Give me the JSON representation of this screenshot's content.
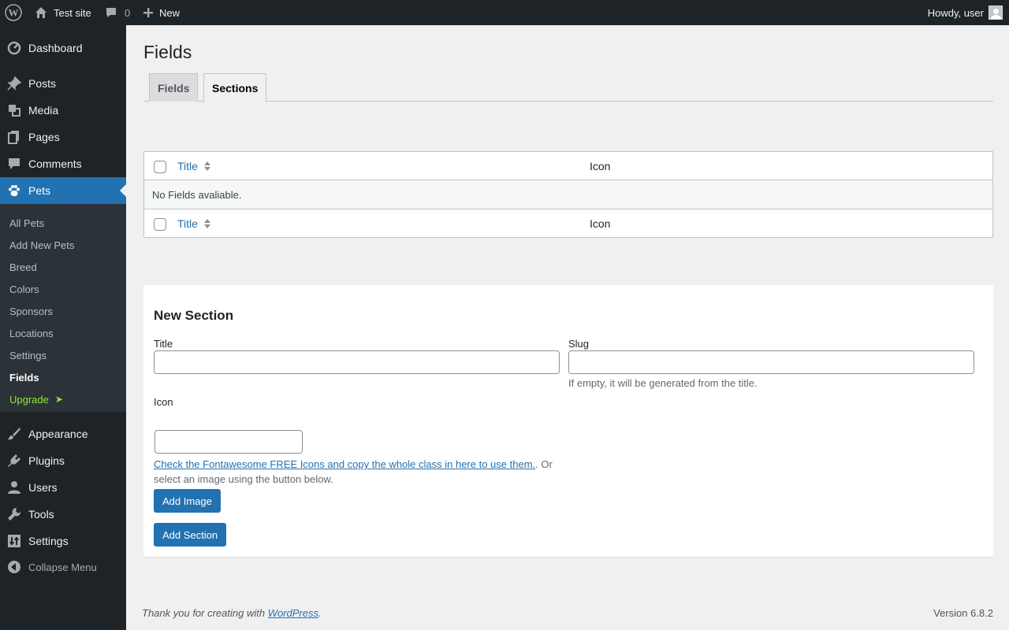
{
  "adminbar": {
    "site_name": "Test site",
    "comments_count": "0",
    "new_label": "New",
    "howdy": "Howdy, user"
  },
  "menu": {
    "dashboard": "Dashboard",
    "posts": "Posts",
    "media": "Media",
    "pages": "Pages",
    "comments": "Comments",
    "pets": "Pets",
    "appearance": "Appearance",
    "plugins": "Plugins",
    "users": "Users",
    "tools": "Tools",
    "settings": "Settings",
    "collapse": "Collapse Menu",
    "submenu": [
      "All Pets",
      "Add New Pets",
      "Breed",
      "Colors",
      "Sponsors",
      "Locations",
      "Settings",
      "Fields",
      "Upgrade"
    ],
    "upgrade_arrow": "➤"
  },
  "page": {
    "title": "Fields",
    "tabs": [
      "Fields",
      "Sections"
    ],
    "active_tab": "Sections"
  },
  "table": {
    "columns": [
      "Title",
      "Icon"
    ],
    "empty_message": "No Fields avaliable."
  },
  "form": {
    "heading": "New Section",
    "title_label": "Title",
    "title_value": "",
    "slug_label": "Slug",
    "slug_value": "",
    "slug_help": "If empty, it will be generated from the title.",
    "icon_label": "Icon",
    "icon_value": "",
    "icon_link_text": "Check the Fontawesome FREE Icons and copy the whole class in here to use them.",
    "icon_help_rest": ". Or select an image using the button below.",
    "add_image_button": "Add Image",
    "add_section_button": "Add Section"
  },
  "footer": {
    "thanks_prefix": "Thank you for creating with ",
    "wordpress_link": "WordPress",
    "thanks_suffix": ".",
    "version": "Version 6.8.2"
  },
  "colors": {
    "admin_dark": "#1d2327",
    "submenu_bg": "#2c3338",
    "accent": "#2271b1",
    "upgrade": "#8ee92f",
    "page_bg": "#f0f0f1"
  }
}
